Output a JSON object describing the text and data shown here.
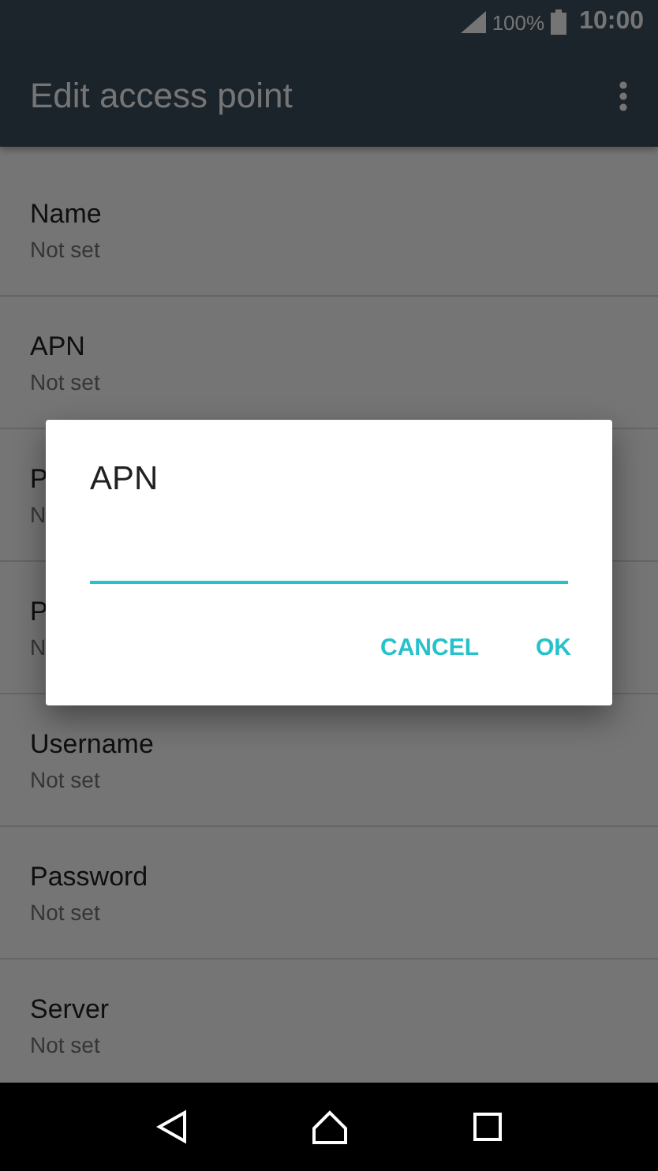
{
  "status_bar": {
    "battery": "100%",
    "time": "10:00"
  },
  "app_bar": {
    "title": "Edit access point"
  },
  "settings": [
    {
      "label": "Name",
      "value": "Not set"
    },
    {
      "label": "APN",
      "value": "Not set"
    },
    {
      "label": "P",
      "value": "N"
    },
    {
      "label": "P",
      "value": "N"
    },
    {
      "label": "Username",
      "value": "Not set"
    },
    {
      "label": "Password",
      "value": "Not set"
    },
    {
      "label": "Server",
      "value": "Not set"
    }
  ],
  "dialog": {
    "title": "APN",
    "buttons": [
      "CANCEL",
      "OK"
    ]
  }
}
